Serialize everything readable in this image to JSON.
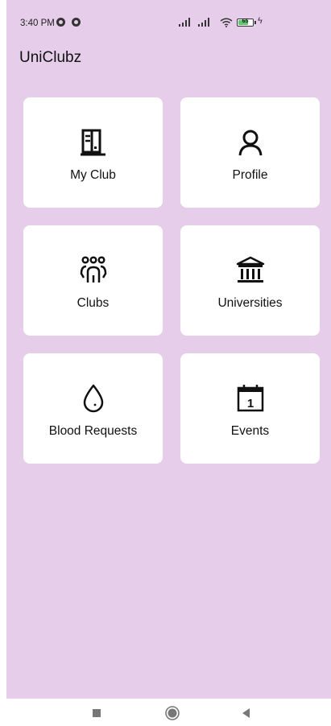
{
  "status_bar": {
    "time": "3:40 PM",
    "battery": "65"
  },
  "app": {
    "title": "UniClubz"
  },
  "menu": [
    {
      "label": "My Club",
      "icon": "book-icon"
    },
    {
      "label": "Profile",
      "icon": "person-icon"
    },
    {
      "label": "Clubs",
      "icon": "group-icon"
    },
    {
      "label": "Universities",
      "icon": "institution-icon"
    },
    {
      "label": "Blood Requests",
      "icon": "droplet-icon"
    },
    {
      "label": "Events",
      "icon": "calendar-icon"
    }
  ],
  "calendar_day": "1",
  "colors": {
    "background": "#e6cdea",
    "card": "#ffffff",
    "battery": "#5cc86a"
  }
}
